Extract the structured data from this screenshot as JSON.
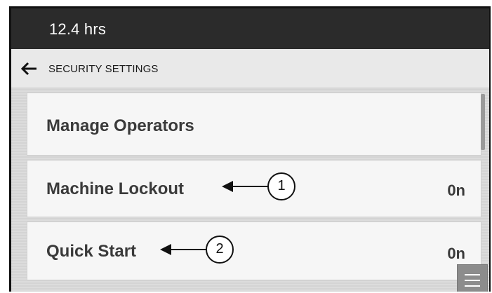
{
  "status_bar": {
    "hours": "12.4 hrs"
  },
  "header": {
    "title": "SECURITY SETTINGS",
    "back_icon": "arrow-left-icon"
  },
  "items": [
    {
      "label": "Manage Operators",
      "value": ""
    },
    {
      "label": "Machine Lockout",
      "value": "0n"
    },
    {
      "label": "Quick Start",
      "value": "0n"
    }
  ],
  "callouts": [
    {
      "number": "1"
    },
    {
      "number": "2"
    }
  ],
  "menu": {
    "icon": "hamburger-menu-icon"
  },
  "colors": {
    "status_bar_bg": "#2b2b2b",
    "header_bg": "#e9e9e9",
    "item_bg": "#f6f6f6",
    "item_text": "#3a3a3a",
    "menu_button_bg": "#8c8c8c"
  }
}
